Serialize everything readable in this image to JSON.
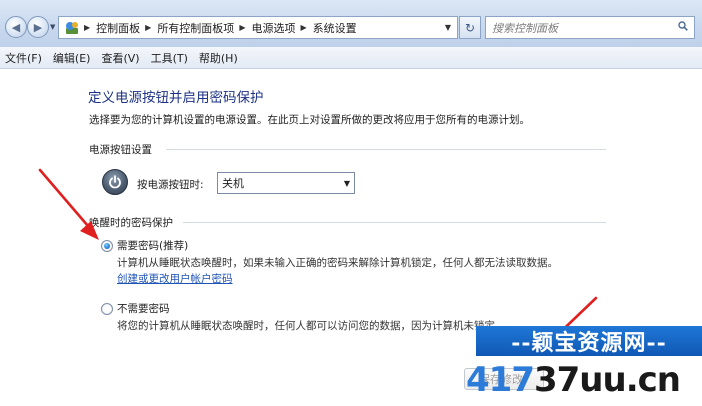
{
  "window": {
    "breadcrumbs": [
      "控制面板",
      "所有控制面板项",
      "电源选项",
      "系统设置"
    ],
    "search_placeholder": "搜索控制面板"
  },
  "menu": [
    "文件(F)",
    "编辑(E)",
    "查看(V)",
    "工具(T)",
    "帮助(H)"
  ],
  "page": {
    "title": "定义电源按钮并启用密码保护",
    "description": "选择要为您的计算机设置的电源设置。在此页上对设置所做的更改将应用于您所有的电源计划。"
  },
  "power_section": {
    "heading": "电源按钮设置",
    "field_label": "按电源按钮时:",
    "selected_value": "关机"
  },
  "password_section": {
    "heading": "唤醒时的密码保护",
    "options": [
      {
        "label": "需要密码(推荐)",
        "checked": true,
        "description": "计算机从睡眠状态唤醒时，如果未输入正确的密码来解除计算机锁定，任何人都无法读取数据。",
        "link": "创建或更改用户帐户密码"
      },
      {
        "label": "不需要密码",
        "checked": false,
        "description": "将您的计算机从睡眠状态唤醒时，任何人都可以访问您的数据，因为计算机未锁定。"
      }
    ]
  },
  "footer": {
    "save_label": "保存修改"
  },
  "watermark": {
    "top_text": "--颖宝资源网--",
    "number": "417",
    "domain": "37uu.cn"
  },
  "colors": {
    "title": "#1e3287",
    "link": "#1e53b6",
    "annotation_arrow": "#e02020",
    "watermark_blue": "#1f77d6"
  }
}
